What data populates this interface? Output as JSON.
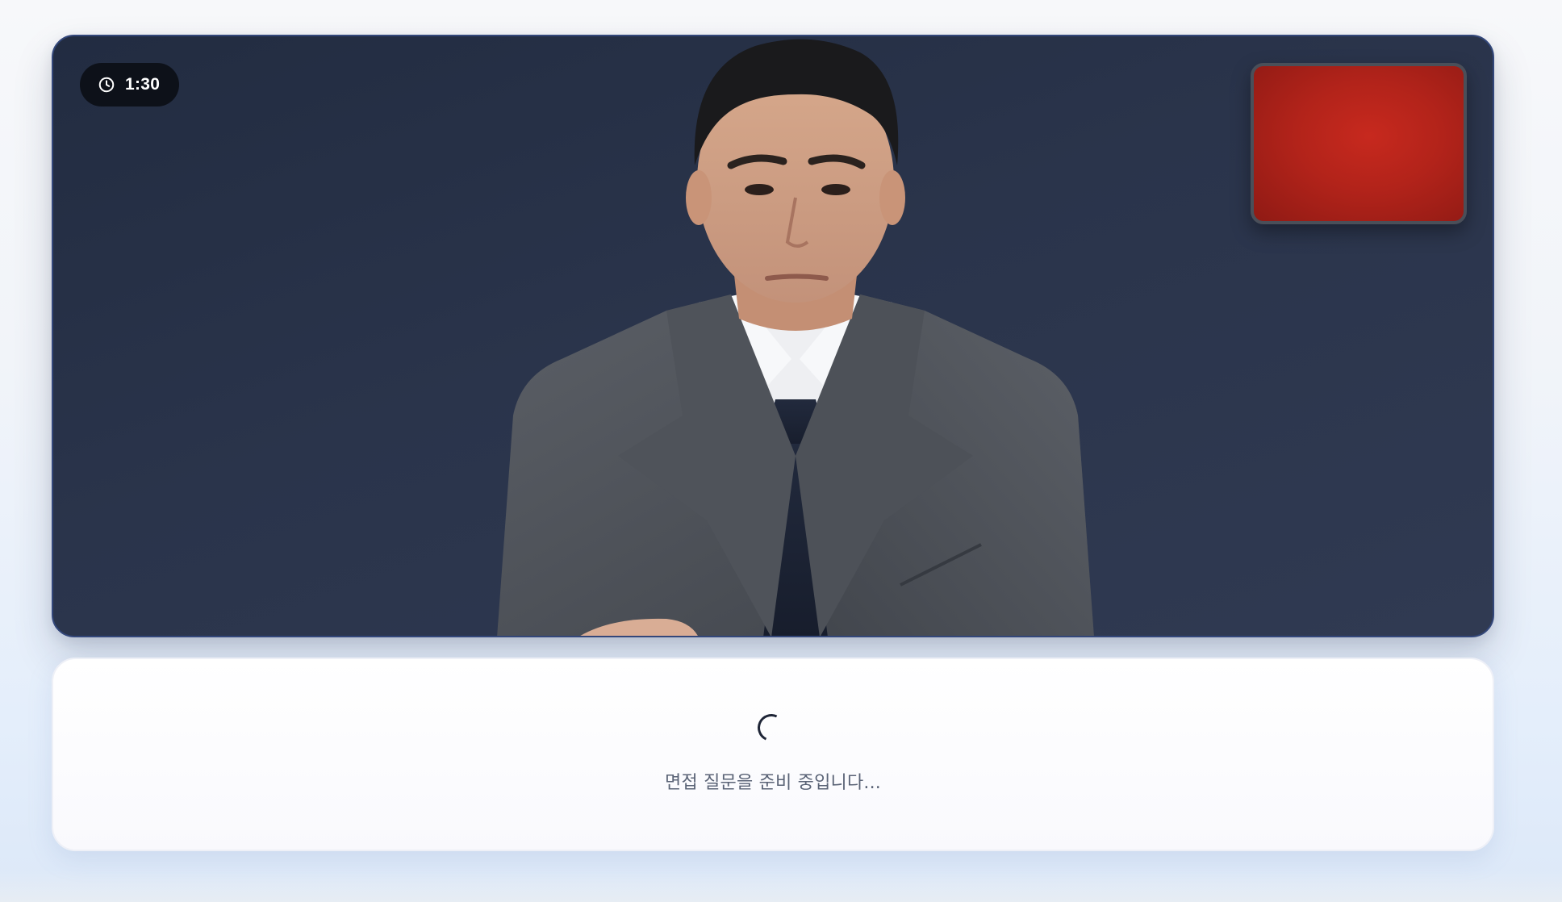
{
  "timer": {
    "label": "1:30",
    "icon": "clock-icon"
  },
  "stage": {
    "background_color": "#2a344b",
    "border_color": "#33477a"
  },
  "self_view": {
    "color": "#b2231a"
  },
  "status": {
    "message": "면접 질문을 준비 중입니다...",
    "icon": "loading-spinner"
  }
}
